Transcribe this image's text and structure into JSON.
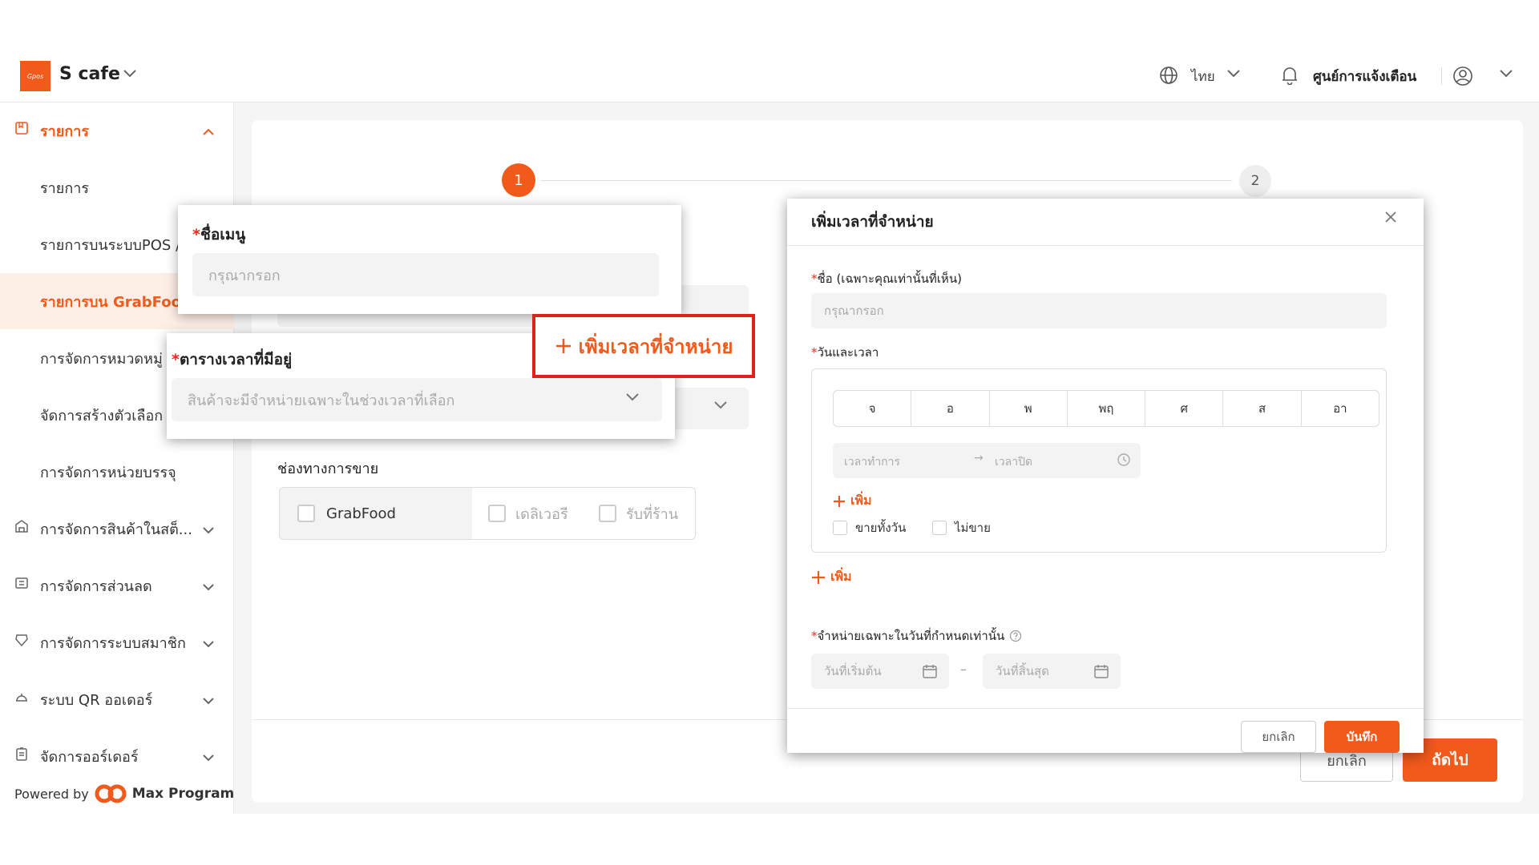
{
  "topbar": {
    "logo_text": "Gpos",
    "store_name": "S cafe",
    "language": "ไทย",
    "notification_center": "ศูนย์การแจ้งเตือน"
  },
  "sidebar": {
    "items": [
      {
        "label": "รายการ",
        "icon": "menu-book-icon"
      },
      {
        "label": "รายการ"
      },
      {
        "label": "รายการบนระบบPOS /"
      },
      {
        "label": "รายการบน GrabFood"
      },
      {
        "label": "การจัดการหมวดหมู่"
      },
      {
        "label": "จัดการสร้างตัวเลือก"
      },
      {
        "label": "การจัดการหน่วยบรรจุ"
      },
      {
        "label": "การจัดการสินค้าในสต็...",
        "icon": "warehouse-icon"
      },
      {
        "label": "การจัดการส่วนลด",
        "icon": "coupon-icon"
      },
      {
        "label": "การจัดการระบบสมาชิก",
        "icon": "member-icon"
      },
      {
        "label": "ระบบ QR ออเดอร์",
        "icon": "service-bell-icon"
      },
      {
        "label": "จัดการออร์เดอร์",
        "icon": "clipboard-icon"
      }
    ],
    "powered_by": "Powered by",
    "brand": "Max Program"
  },
  "wizard": {
    "step1": "1",
    "step2": "2"
  },
  "form": {
    "channels_label": "ช่องทางการขาย",
    "channels": {
      "grabfood": "GrabFood",
      "delivery": "เดลิเวอรี",
      "pickup": "รับที่ร้าน"
    },
    "cancel": "ยกเลิก",
    "next": "ถัดไป"
  },
  "popup_menu_name": {
    "label": "ชื่อเมนู",
    "placeholder": "กรุณากรอก"
  },
  "popup_schedule": {
    "label": "ตารางเวลาที่มีอยู่",
    "placeholder": "สินค้าจะมีจำหน่ายเฉพาะในช่วงเวลาที่เลือก"
  },
  "highlight_button": {
    "label": "เพิ่มเวลาที่จำหน่าย"
  },
  "modal": {
    "title": "เพิ่มเวลาที่จำหน่าย",
    "name_label": "ชื่อ (เฉพาะคุณเท่านั้นที่เห็น)",
    "name_placeholder": "กรุณากรอก",
    "datetime_label": "วันและเวลา",
    "days": [
      "จ",
      "อ",
      "พ",
      "พฤ",
      "ศ",
      "ส",
      "อา"
    ],
    "open_time": "เวลาทำการ",
    "close_time": "เวลาปิด",
    "add": "เพิ่ม",
    "all_day": "ขายทั้งวัน",
    "not_sell": "ไม่ขาย",
    "add_outer": "เพิ่ม",
    "only_dates_label": "จำหน่ายเฉพาะในวันที่กำหนดเท่านั้น",
    "start_date": "วันที่เริ่มต้น",
    "end_date": "วันที่สิ้นสุด",
    "cancel": "ยกเลิก",
    "save": "บันทึก"
  },
  "colors": {
    "accent": "#f15a1b",
    "highlight_border": "#e0201a",
    "required": "#e0301e"
  }
}
